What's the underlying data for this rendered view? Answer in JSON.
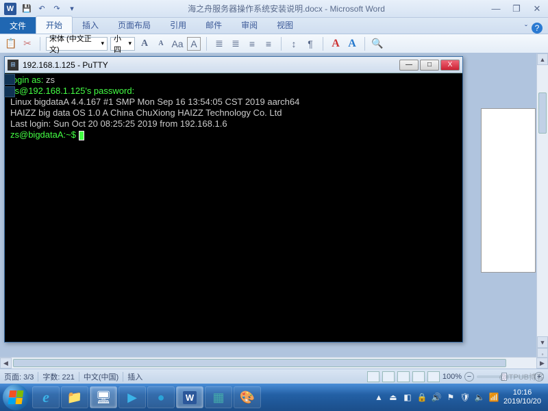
{
  "word": {
    "app_letter": "W",
    "title": "海之舟服务器操作系统安装说明.docx - Microsoft Word",
    "qat": {
      "save": "💾",
      "undo": "↶",
      "redo": "↷",
      "more": "▾"
    },
    "win": {
      "min": "—",
      "max": "❐",
      "close": "✕"
    },
    "tabs": {
      "file": "文件",
      "home": "开始",
      "insert": "插入",
      "layout": "页面布局",
      "references": "引用",
      "mailings": "邮件",
      "review": "审阅",
      "view": "视图"
    },
    "help": {
      "caret": "ˇ",
      "q": "?"
    },
    "ribbon": {
      "paste": "📋",
      "cut": "✂",
      "font_name": "宋体 (中文正文)",
      "font_dd": "▾",
      "font_size": "小四",
      "size_dd": "▾",
      "grow": "A",
      "shrink": "A",
      "aa": "Aa",
      "highlight": "A",
      "bullets": "≣",
      "numbering": "≣",
      "indent_dec": "≡",
      "indent_inc": "≡",
      "sort": "↕",
      "para": "¶",
      "style_a1": "A",
      "style_a2": "A",
      "find": "🔍"
    },
    "status": {
      "page": "页面: 3/3",
      "words": "字数: 221",
      "lang": "中文(中国)",
      "mode": "插入",
      "zoom": "100%",
      "minus": "−",
      "plus": "+"
    }
  },
  "putty": {
    "title": "192.168.1.125 - PuTTY",
    "controls": {
      "min": "—",
      "max": "□",
      "close": "X"
    },
    "lines": [
      {
        "prompt": "login as: ",
        "value": "zs"
      },
      {
        "prompt": "zs@192.168.1.125's password:",
        "value": ""
      },
      {
        "text": "Linux bigdataA 4.4.167 #1 SMP Mon Sep 16 13:54:05 CST 2019 aarch64"
      },
      {
        "text": "HAIZZ big data OS 1.0 A  China ChuXiong HAIZZ Technology Co. Ltd"
      },
      {
        "text": "Last login: Sun Oct 20 08:25:25 2019 from 192.168.1.6"
      },
      {
        "shell": "zs@bigdataA:~$ "
      }
    ]
  },
  "taskbar": {
    "items": [
      {
        "name": "ie",
        "glyph": "e",
        "color": "#3bb3e8"
      },
      {
        "name": "explorer",
        "glyph": "📁",
        "color": ""
      },
      {
        "name": "putty-task",
        "glyph": "🖥",
        "color": "",
        "active": true
      },
      {
        "name": "media-player",
        "glyph": "▶",
        "color": "#3bb3e8"
      },
      {
        "name": "browser",
        "glyph": "●",
        "color": "#2aa3d8"
      },
      {
        "name": "word-task",
        "glyph": "W",
        "color": "#2b579a",
        "active": true
      },
      {
        "name": "task-view",
        "glyph": "▦",
        "color": "#4aa"
      },
      {
        "name": "paint",
        "glyph": "🎨",
        "color": ""
      }
    ],
    "tray_icons": [
      "▲",
      "⏏",
      "◧",
      "🔒",
      "🔊",
      "⚑",
      "🛡",
      "🔈",
      "📶"
    ],
    "time": "10:16",
    "date": "2019/10/20"
  },
  "watermark": "@ITPUB博客"
}
